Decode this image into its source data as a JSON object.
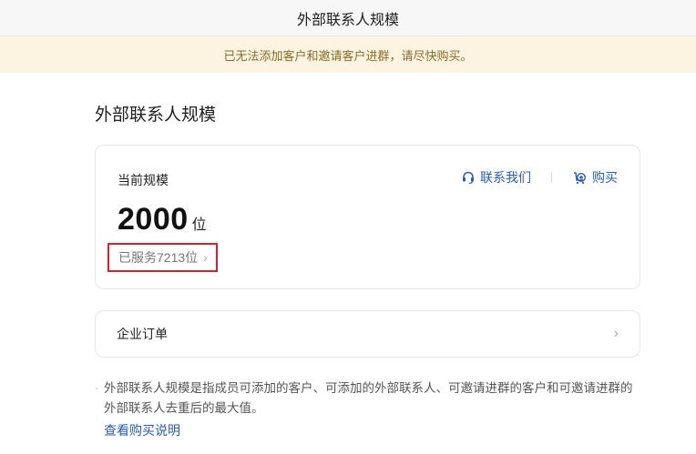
{
  "window": {
    "title": "外部联系人规模"
  },
  "banner": {
    "text": "已无法添加客户和邀请客户进群，请尽快购买。"
  },
  "page": {
    "title": "外部联系人规模"
  },
  "scale_card": {
    "label": "当前规模",
    "contact_label": "联系我们",
    "buy_label": "购买",
    "value": "2000",
    "unit": "位",
    "served_text": "已服务7213位",
    "chevron": "›"
  },
  "orders_card": {
    "label": "企业订单",
    "chevron": "›"
  },
  "note": {
    "bullet": "·",
    "text": "外部联系人规模是指成员可添加的客户、可添加的外部联系人、可邀请进群的客户和可邀请进群的外部联系人去重后的最大值。"
  },
  "link": {
    "text": "查看购买说明"
  },
  "colors": {
    "accent": "#2a5db0",
    "banner_bg": "#fcf4e0",
    "banner_text": "#8a6a2a",
    "highlight": "#d6202a"
  },
  "icons": {
    "contact": "headset-icon",
    "buy": "cart-plus-icon"
  }
}
